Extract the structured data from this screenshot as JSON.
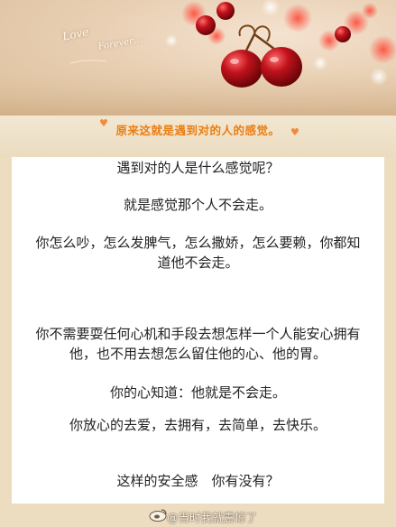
{
  "banner": {
    "love": "Love",
    "forever": "Forever…"
  },
  "subtitle": "原来这就是遇到对的人的感觉。",
  "body": {
    "p1": "遇到对的人是什么感觉呢？",
    "p2": "就是感觉那个人不会走。",
    "p3_l1": "你怎么吵，怎么发脾气，怎么撒娇，怎么要赖，你都知",
    "p3_l2": "道他不会走。",
    "p4_l1": "你不需要耍任何心机和手段去想怎样一个人能安心拥有",
    "p4_l2": "他，也不用去想怎么留住他的心、他的胃。",
    "p5": "你的心知道：他就是不会走。",
    "p6": "你放心的去爱，去拥有，去简单，去快乐。",
    "p7": "这样的安全感　你有没有？"
  },
  "watermark": "@当时我就震惊了",
  "colors": {
    "accent": "#ec7d12",
    "cherry": "#b5121b"
  }
}
